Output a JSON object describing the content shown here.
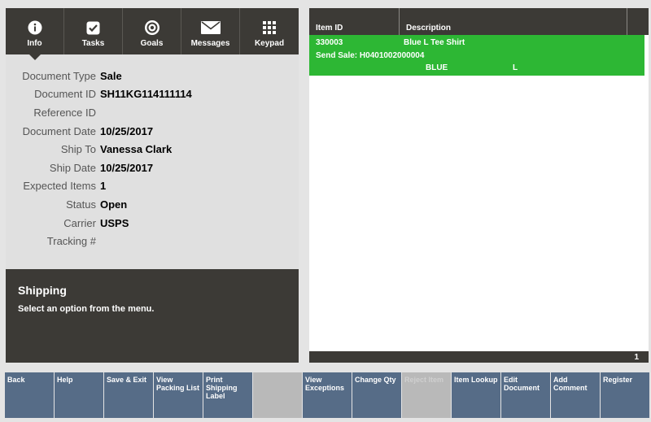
{
  "tabs": [
    {
      "label": "Info",
      "icon": "info-icon"
    },
    {
      "label": "Tasks",
      "icon": "checkbox-icon"
    },
    {
      "label": "Goals",
      "icon": "target-icon"
    },
    {
      "label": "Messages",
      "icon": "envelope-icon"
    },
    {
      "label": "Keypad",
      "icon": "keypad-icon"
    }
  ],
  "fields": [
    {
      "label": "Document Type",
      "value": "Sale"
    },
    {
      "label": "Document ID",
      "value": "SH11KG114111114"
    },
    {
      "label": "Reference ID",
      "value": ""
    },
    {
      "label": "Document Date",
      "value": "10/25/2017"
    },
    {
      "label": "Ship To",
      "value": "Vanessa Clark"
    },
    {
      "label": "Ship Date",
      "value": "10/25/2017"
    },
    {
      "label": "Expected Items",
      "value": "1"
    },
    {
      "label": "Status",
      "value": "Open"
    },
    {
      "label": "Carrier",
      "value": "USPS"
    },
    {
      "label": "Tracking #",
      "value": ""
    }
  ],
  "info_panel": {
    "title": "Shipping",
    "message": "Select an option from the menu."
  },
  "table": {
    "headers": {
      "item_id": "Item ID",
      "description": "Description"
    },
    "rows": [
      {
        "item_id": "330003",
        "description": "Blue L Tee Shirt",
        "send_sale": "Send Sale: H0401002000004",
        "color": "BLUE",
        "size": "L"
      }
    ],
    "footer_count": "1"
  },
  "buttons": [
    {
      "label": "Back",
      "enabled": true
    },
    {
      "label": "Help",
      "enabled": true
    },
    {
      "label": "Save & Exit",
      "enabled": true
    },
    {
      "label": "View Packing List",
      "enabled": true
    },
    {
      "label": "Print Shipping Label",
      "enabled": true
    },
    {
      "label": "",
      "enabled": false
    },
    {
      "label": "View Exceptions",
      "enabled": true
    },
    {
      "label": "Change Qty",
      "enabled": true
    },
    {
      "label": "Reject Item",
      "enabled": false
    },
    {
      "label": "Item Lookup",
      "enabled": true
    },
    {
      "label": "Edit Document",
      "enabled": true
    },
    {
      "label": "Add Comment",
      "enabled": true
    },
    {
      "label": "Register",
      "enabled": true
    }
  ],
  "colors": {
    "dark": "#3c3a36",
    "selected_row": "#2db734",
    "button": "#566c87",
    "button_disabled": "#b9b9b9"
  }
}
